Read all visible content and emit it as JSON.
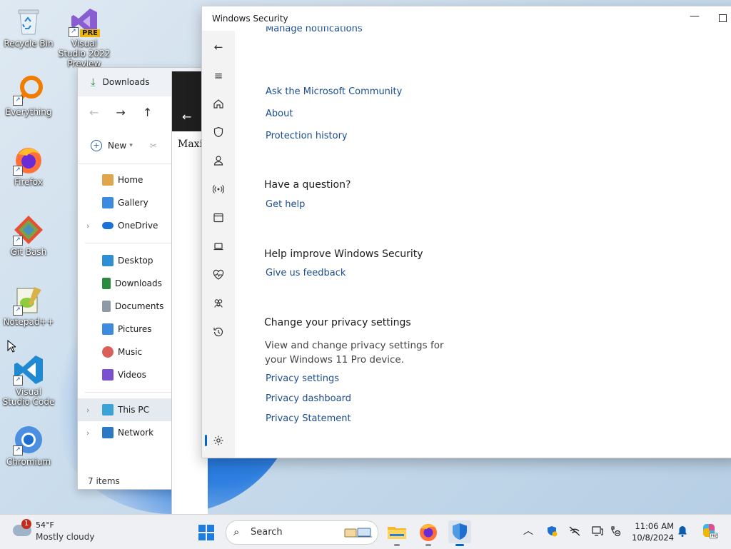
{
  "desktop": {
    "icons": [
      {
        "label": "Recycle Bin",
        "icon": "recycle-bin-icon"
      },
      {
        "label": "Visual Studio 2022 Preview",
        "icon": "visual-studio-icon",
        "badge": "PRE"
      },
      {
        "label": "Everything",
        "icon": "everything-search-icon"
      },
      {
        "label": "Firefox",
        "icon": "firefox-icon"
      },
      {
        "label": "Git Bash",
        "icon": "git-bash-icon"
      },
      {
        "label": "Notepad++",
        "icon": "notepadpp-icon"
      },
      {
        "label": "Visual Studio Code",
        "icon": "vscode-icon"
      },
      {
        "label": "Chromium",
        "icon": "chromium-icon"
      }
    ]
  },
  "explorer": {
    "tab_title": "Downloads",
    "new_label": "New",
    "quick_items": [
      {
        "label": "Home",
        "icon": "home-icon"
      },
      {
        "label": "Gallery",
        "icon": "gallery-icon"
      },
      {
        "label": "OneDrive",
        "icon": "onedrive-icon"
      }
    ],
    "pinned_items": [
      {
        "label": "Desktop",
        "icon": "desktop-folder-icon"
      },
      {
        "label": "Downloads",
        "icon": "downloads-folder-icon"
      },
      {
        "label": "Documents",
        "icon": "documents-folder-icon"
      },
      {
        "label": "Pictures",
        "icon": "pictures-folder-icon"
      },
      {
        "label": "Music",
        "icon": "music-folder-icon"
      },
      {
        "label": "Videos",
        "icon": "videos-folder-icon"
      }
    ],
    "drive_items": [
      {
        "label": "This PC",
        "icon": "this-pc-icon"
      },
      {
        "label": "Network",
        "icon": "network-icon"
      }
    ],
    "status": "7 items"
  },
  "background_window": {
    "text": "Maxi"
  },
  "security": {
    "title": "Windows Security",
    "cut_off_link": "Manage notifications",
    "links_top": [
      "Ask the Microsoft Community",
      "About",
      "Protection history"
    ],
    "question_heading": "Have a question?",
    "get_help": "Get help",
    "improve_heading": "Help improve Windows Security",
    "feedback": "Give us feedback",
    "privacy_heading": "Change your privacy settings",
    "privacy_para": "View and change privacy settings for your Windows 11 Pro device.",
    "privacy_links": [
      "Privacy settings",
      "Privacy dashboard",
      "Privacy Statement"
    ],
    "rail_icons": [
      "back-arrow-icon",
      "hamburger-menu-icon",
      "home-icon",
      "shield-icon",
      "account-icon",
      "firewall-network-icon",
      "app-browser-control-icon",
      "device-security-icon",
      "device-health-icon",
      "family-options-icon",
      "protection-history-icon",
      "settings-gear-icon"
    ]
  },
  "taskbar": {
    "weather_badge": "1",
    "temperature": "54°F",
    "condition": "Mostly cloudy",
    "search_placeholder": "Search",
    "time": "11:06 AM",
    "date": "10/8/2024",
    "accent": "#0067c0"
  }
}
